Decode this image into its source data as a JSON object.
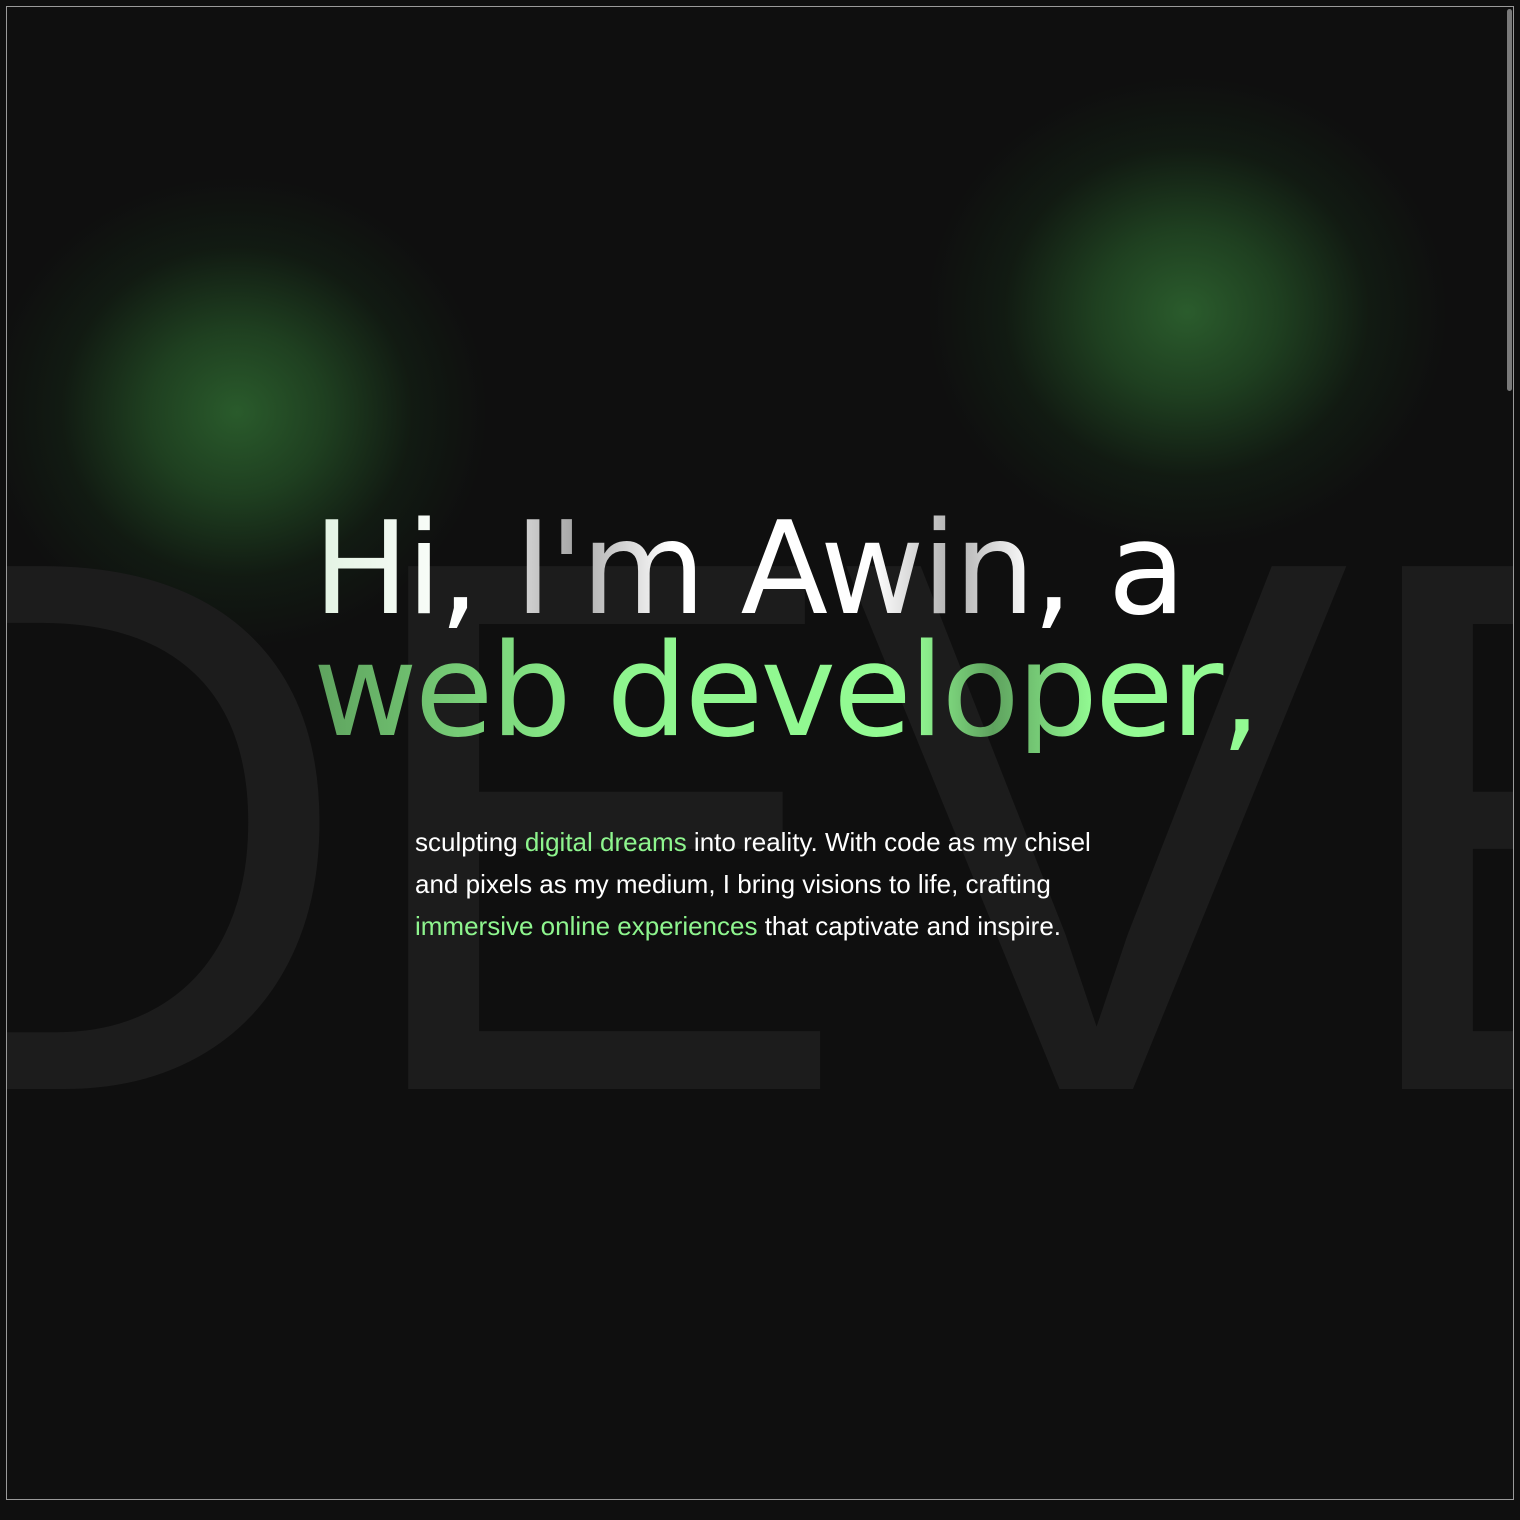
{
  "hero": {
    "background_word": "DEVE",
    "headline_line1": "Hi, I'm Awin, a",
    "headline_line2": "web developer,",
    "intro": {
      "seg1": "sculpting ",
      "seg2": "digital dreams",
      "seg3": " into reality. With code as my chisel and pixels as my medium, I bring visions to life, crafting ",
      "seg4": "immersive online experiences",
      "seg5": " that captivate and inspire."
    }
  },
  "colors": {
    "background": "#0f0f0f",
    "accent_green": "#8ef58e",
    "glow_green": "#2b5f2d",
    "text": "#ffffff"
  }
}
